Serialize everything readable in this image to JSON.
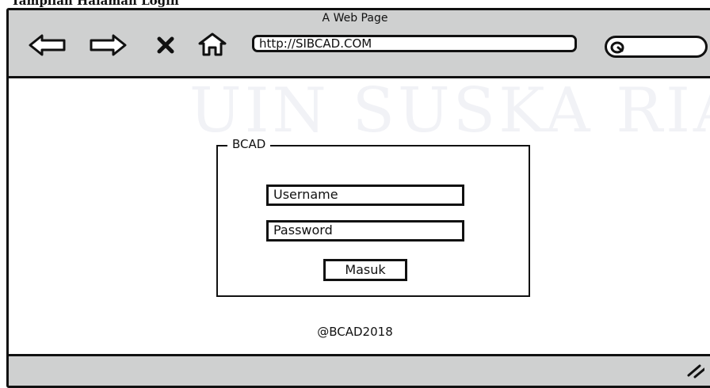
{
  "caption": "Tampilan Halaman Login",
  "window": {
    "title": "A Web Page",
    "url": "http://SIBCAD.COM"
  },
  "watermark": "UIN SUSKA RIAU",
  "login": {
    "legend": "BCAD",
    "username_placeholder": "Username",
    "password_placeholder": "Password",
    "submit_label": "Masuk"
  },
  "footer": "@BCAD2018",
  "icons": {
    "back": "back-arrow-icon",
    "forward": "forward-arrow-icon",
    "stop": "close-icon",
    "home": "home-icon",
    "search": "search-icon",
    "resize": "resize-grip-icon"
  },
  "colors": {
    "chrome": "#cfd0d0",
    "ink": "#111111",
    "watermark": "#f1f2f6"
  }
}
